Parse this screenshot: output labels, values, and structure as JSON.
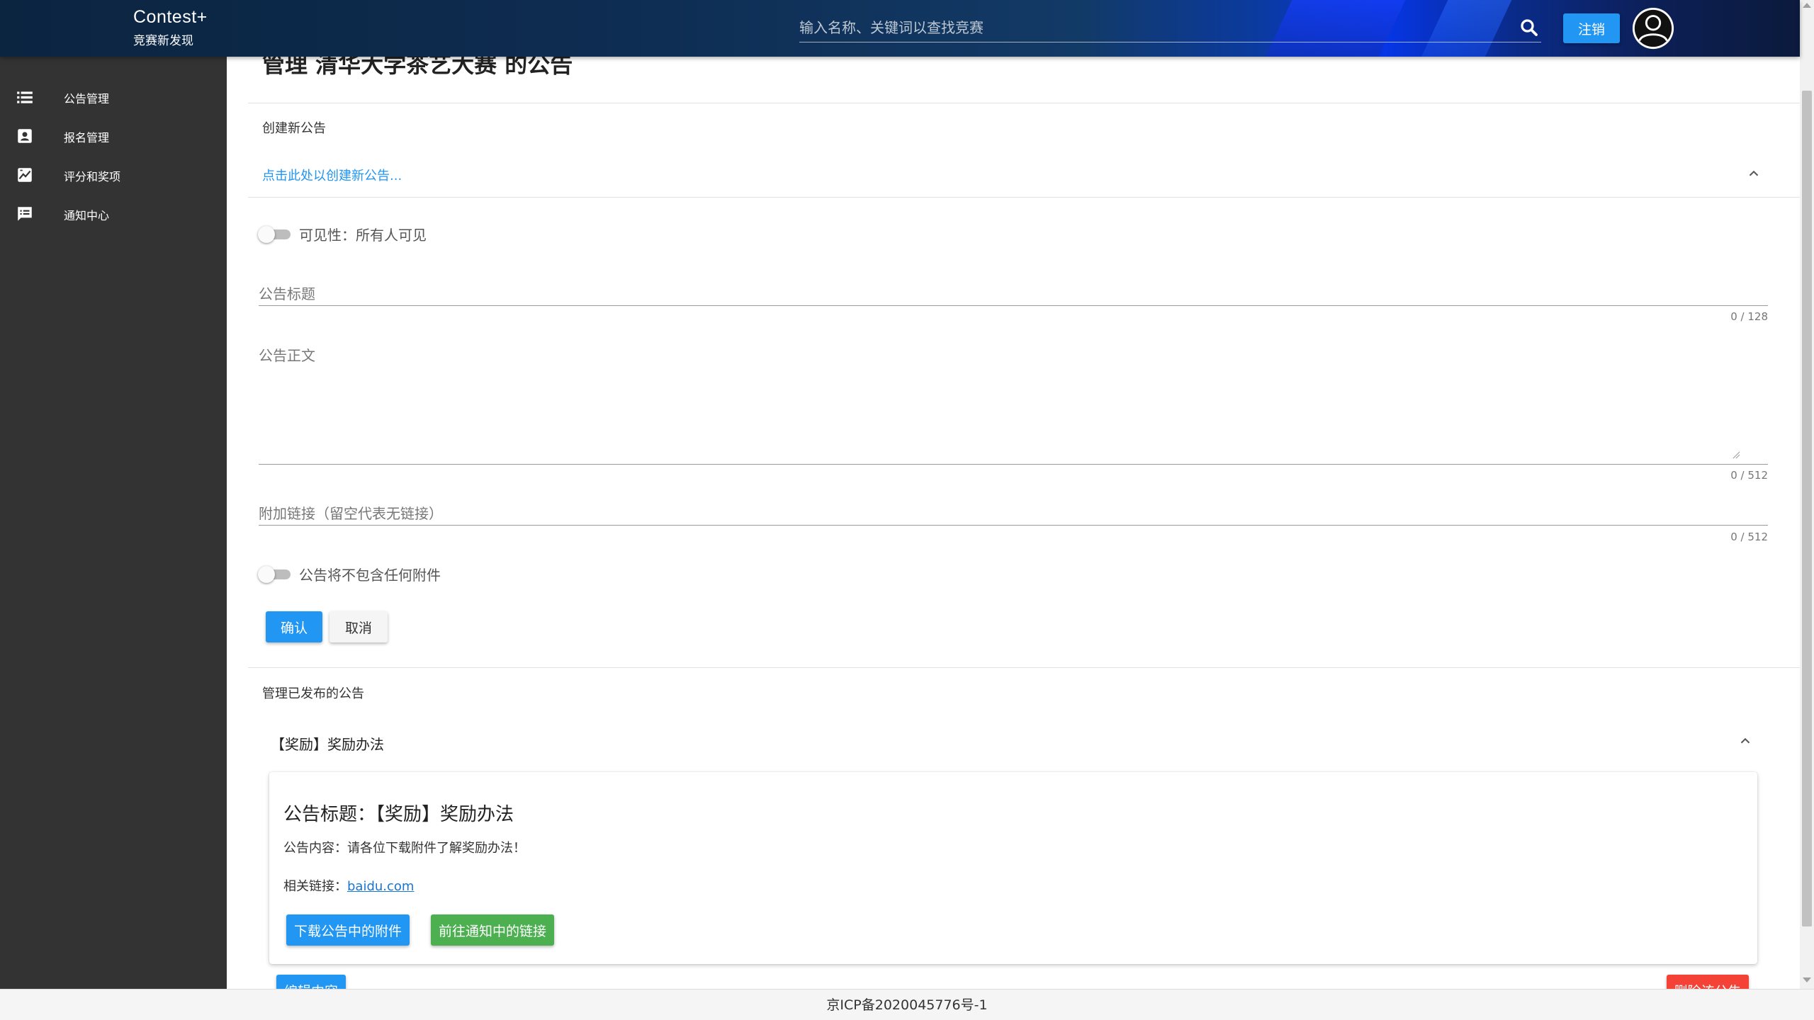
{
  "header": {
    "brand_name": "Contest+",
    "brand_sub": "竞赛新发现",
    "search_placeholder": "输入名称、关键词以查找竞赛",
    "logout_label": "注销"
  },
  "sidebar": {
    "items": [
      {
        "label": "公告管理",
        "icon": "list-icon"
      },
      {
        "label": "报名管理",
        "icon": "contact-card-icon"
      },
      {
        "label": "评分和奖项",
        "icon": "grade-chart-icon"
      },
      {
        "label": "通知中心",
        "icon": "message-icon"
      }
    ]
  },
  "main": {
    "page_title": "管理 清华大学茶艺大赛 的公告",
    "create_section": {
      "label": "创建新公告",
      "expand_link": "点击此处以创建新公告...",
      "visibility_label": "可见性：所有人可见",
      "title_field": {
        "label": "公告标题",
        "value": "",
        "counter": "0 / 128"
      },
      "body_field": {
        "label": "公告正文",
        "value": "",
        "counter": "0 / 512"
      },
      "link_field": {
        "label": "附加链接（留空代表无链接）",
        "value": "",
        "counter": "0 / 512"
      },
      "attachment_label": "公告将不包含任何附件",
      "confirm_label": "确认",
      "cancel_label": "取消"
    },
    "manage_section": {
      "label": "管理已发布的公告",
      "announcement": {
        "header": "【奖励】奖励办法",
        "title_line": "公告标题：【奖励】奖励办法",
        "content_line": "公告内容：请各位下载附件了解奖励办法！",
        "link_prefix": "相关链接：",
        "link_text": "baidu.com",
        "download_label": "下载公告中的附件",
        "goto_label": "前往通知中的链接",
        "edit_label": "编辑内容",
        "delete_label": "删除该公告"
      }
    }
  },
  "footer": {
    "icp": "京ICP备2020045776号-1"
  },
  "colors": {
    "primary": "#2196f3",
    "success": "#4caf50",
    "danger": "#f44336",
    "sidebar_bg": "#333333"
  }
}
